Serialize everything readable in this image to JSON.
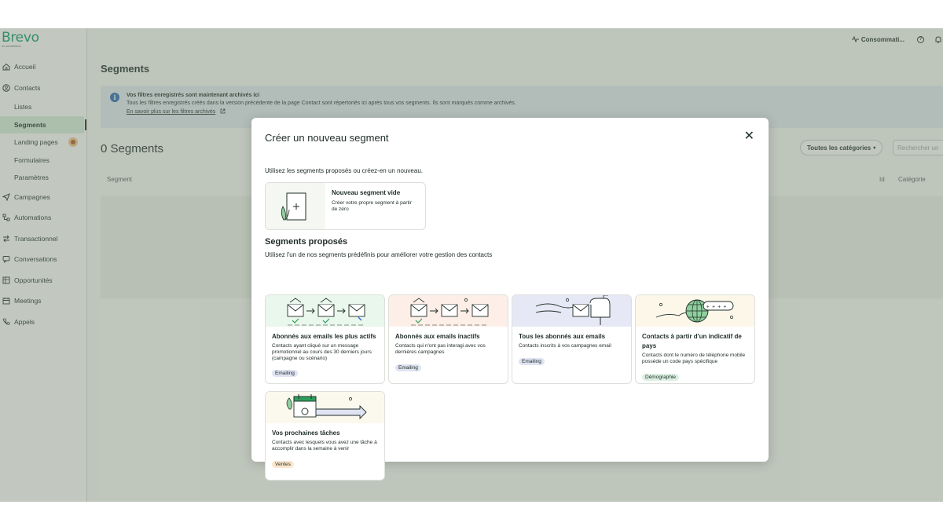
{
  "app": {
    "logo": "Brevo",
    "logo_sub": "ex sendinblue"
  },
  "sidebar": {
    "items": [
      {
        "label": "Accueil"
      },
      {
        "label": "Contacts"
      },
      {
        "label": "Listes"
      },
      {
        "label": "Segments"
      },
      {
        "label": "Landing pages"
      },
      {
        "label": "Formulaires"
      },
      {
        "label": "Paramètres"
      },
      {
        "label": "Campagnes"
      },
      {
        "label": "Automations"
      },
      {
        "label": "Transactionnel"
      },
      {
        "label": "Conversations"
      },
      {
        "label": "Opportunités"
      },
      {
        "label": "Meetings"
      },
      {
        "label": "Appels"
      }
    ]
  },
  "topbar": {
    "consumption": "Consommati..."
  },
  "page": {
    "title": "Segments",
    "banner_title": "Vos filtres enregistrés sont maintenant archivés ici",
    "banner_text": "Tous les filtres enregistrés créés dans la version précédente de la page Contact sont répertoriés ici après tous vos segments. Ils sont marqués comme archivés.",
    "banner_link": "En savoir plus sur les filtres archivés",
    "count": "0 Segments",
    "filter_label": "Toutes les catégories",
    "search_placeholder": "Rechercher un",
    "col_segment": "Segment",
    "col_id": "Id",
    "col_category": "Catégorie"
  },
  "modal": {
    "title": "Créer un nouveau segment",
    "intro": "Utilisez les segments proposés ou créez-en un nouveau.",
    "new_title": "Nouveau segment vide",
    "new_desc": "Créer votre propre segment à partir de zéro",
    "section_title": "Segments proposés",
    "section_sub": "Utilisez l'un de nos segments prédéfinis pour améliorer votre gestion des contacts",
    "cards": [
      {
        "title": "Abonnés aux emails les plus actifs",
        "desc": "Contacts ayant cliqué sur un message promotionnel au cours des 30 derniers jours (campagne ou scénario)",
        "tag": "Emailing"
      },
      {
        "title": "Abonnés aux emails inactifs",
        "desc": "Contacts qui n'ont pas interagi avec vos dernières campagnes",
        "tag": "Emailing"
      },
      {
        "title": "Tous les abonnés aux emails",
        "desc": "Contacts inscrits à vos campagnes email",
        "tag": "Emailing"
      },
      {
        "title": "Contacts à partir d'un indicatif de pays",
        "desc": "Contacts dont le numéro de téléphone mobile possède un code pays spécifique",
        "tag": "Démographie"
      },
      {
        "title": "Vos prochaines tâches",
        "desc": "Contacts avec lesquels vous avez une tâche à accomplir dans la semaine à venir",
        "tag": "Ventes"
      }
    ],
    "illustration_texts": {
      "phone": "+ + + +"
    }
  },
  "colors": {
    "brand": "#0b996e",
    "active_nav": "#d9f0df",
    "overlay": "#6e7d69"
  }
}
